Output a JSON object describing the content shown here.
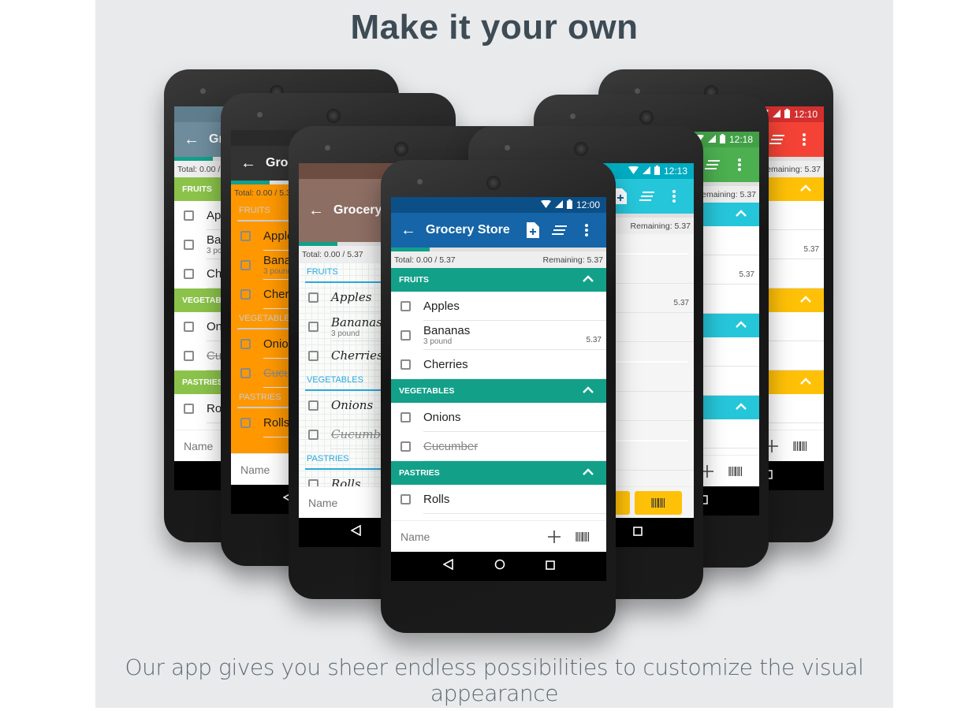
{
  "title": "Make it your own",
  "subtitle": "Our app gives you sheer endless possibilities to customize the visual appearance",
  "list": {
    "title": "Grocery Store",
    "short_title": "Grocery",
    "total": "Total: 0.00 / 5.37",
    "remaining": "Remaining: 5.37",
    "name_placeholder": "Name",
    "sections": [
      {
        "name": "FRUITS",
        "items": [
          {
            "name": "Apples"
          },
          {
            "name": "Bananas",
            "qty": "3 pound",
            "price": "5.37"
          },
          {
            "name": "Cherries"
          }
        ]
      },
      {
        "name": "VEGETABLES",
        "items": [
          {
            "name": "Onions"
          },
          {
            "name": "Cucumber",
            "checked_out": true
          }
        ]
      },
      {
        "name": "PASTRIES",
        "items": [
          {
            "name": "Rolls"
          }
        ]
      }
    ]
  },
  "phones": [
    {
      "theme": "blue-grey",
      "status": "#5f7d8c",
      "toolbar": "#6e8c9c",
      "section": "#8bc34a",
      "section_style": "filled",
      "list_bg": "#ffffff",
      "text": "#222222",
      "time": "",
      "title_key": "short_title"
    },
    {
      "theme": "red",
      "status": "#d32f2f",
      "toolbar": "#f44336",
      "section": "#ffc107",
      "section_style": "filled",
      "list_bg": "#ffffff",
      "text": "#222222",
      "time": "12:10",
      "title_key": "title"
    },
    {
      "theme": "orange",
      "status": "#2a2a2a",
      "toolbar": "#333333",
      "section": "#c9cdd0",
      "section_style": "line",
      "list_bg": "#ff9800",
      "text": "#222222",
      "time": "",
      "title_key": "short_title"
    },
    {
      "theme": "green",
      "status": "#43a047",
      "toolbar": "#4caf50",
      "section": "#26c6da",
      "section_style": "filled",
      "list_bg": "#ffffff",
      "text": "#222222",
      "time": "12:18",
      "title_key": "title"
    },
    {
      "theme": "wood",
      "status": "#6d4c41",
      "toolbar": "#8d6e63",
      "section": "#29a9e0",
      "section_style": "line",
      "list_bg": "#fbfbf8",
      "text": "#222222",
      "time": "",
      "title_key": "short_title"
    },
    {
      "theme": "cyan",
      "status": "#00acc1",
      "toolbar": "#26c6da",
      "section": "#ffffff",
      "section_style": "line",
      "list_bg": "#f5f5f5",
      "text": "#222222",
      "time": "12:13",
      "title_key": "title"
    },
    {
      "theme": "teal",
      "status": "#0b4f86",
      "toolbar": "#1565a8",
      "section": "#13a089",
      "section_style": "filled",
      "list_bg": "#ffffff",
      "text": "#222222",
      "time": "12:00",
      "title_key": "title"
    }
  ]
}
